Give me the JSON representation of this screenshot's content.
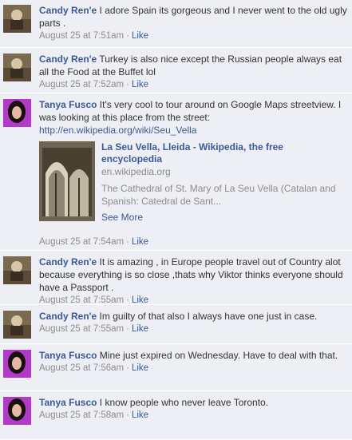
{
  "comments": [
    {
      "author": "Candy Ren'e",
      "text": " I adore Spain its gorgeous and I never went to the old ugly parts .",
      "time": "August 25 at 7:51am",
      "like": "Like",
      "avatar": "candy-avatar"
    },
    {
      "author": "Candy Ren'e",
      "text": " Turkey is also nice except the Russian people always eat all the Food at the Buffet lol",
      "time": "August 25 at 7:52am",
      "like": "Like",
      "avatar": "candy-avatar"
    },
    {
      "author": "Tanya Fusco",
      "text": " It's very cool to tour around on Google Maps streetview. I was looking at this place from the street:",
      "link": "http://en.wikipedia.org/wiki/Seu_Vella",
      "preview": {
        "title": "La Seu Vella, Lleida - Wikipedia, the free encyclopedia",
        "domain": "en.wikipedia.org",
        "description": "The Cathedral of St. Mary of La Seu Vella (Catalan and Spanish: Catedral de Sant...",
        "see_more": "See More"
      },
      "time": "August 25 at 7:54am",
      "like": "Like",
      "avatar": "tanya-avatar"
    },
    {
      "author": "Candy Ren'e",
      "text": " It is amazing , in Europe people travel out of Country alot because everything is so close ,thats why Viktor thinks everyone should have a Passport .",
      "time": "August 25 at 7:55am",
      "like": "Like",
      "avatar": "candy-avatar"
    },
    {
      "author": "Candy Ren'e",
      "text": " Im guilty of that also I always have one just in case.",
      "time": "August 25 at 7:55am",
      "like": "Like",
      "avatar": "candy-avatar"
    },
    {
      "author": "Tanya Fusco",
      "text": " Mine just expired on Wednesday. Have to deal with that.",
      "time": "August 25 at 7:56am",
      "like": "Like",
      "avatar": "tanya-avatar"
    },
    {
      "author": "Tanya Fusco",
      "text": " I know people who never leave Toronto.",
      "time": "August 25 at 7:58am",
      "like": "Like",
      "avatar": "tanya-avatar"
    }
  ],
  "separator": "·"
}
